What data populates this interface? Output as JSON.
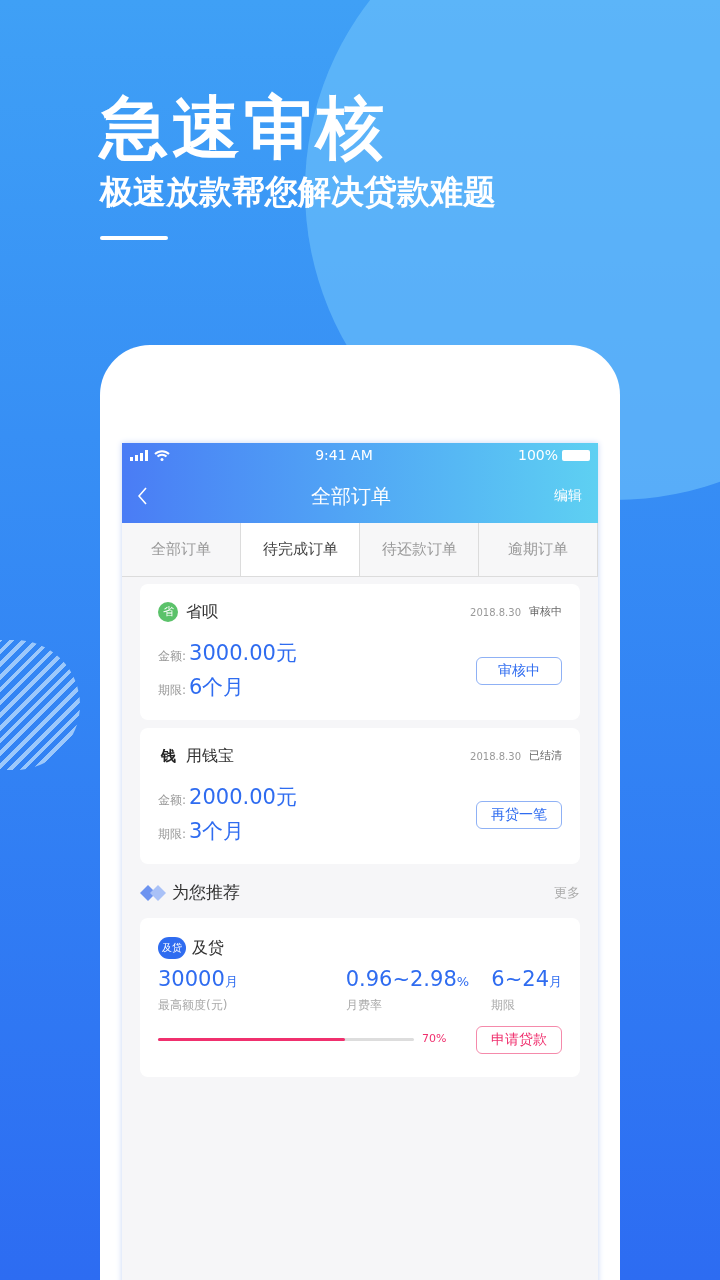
{
  "headline": {
    "title": "急速审核",
    "subtitle": "极速放款帮您解决贷款难题"
  },
  "status_bar": {
    "time": "9:41 AM",
    "battery": "100%"
  },
  "nav": {
    "title": "全部订单",
    "action": "编辑"
  },
  "tabs": [
    {
      "label": "全部订单",
      "selected": false
    },
    {
      "label": "待完成订单",
      "selected": true
    },
    {
      "label": "待还款订单",
      "selected": false
    },
    {
      "label": "逾期订单",
      "selected": false
    }
  ],
  "orders": [
    {
      "logo": "省",
      "kind": "round",
      "name": "省呗",
      "date": "2018.8.30",
      "status": "审核中",
      "amount_label": "金额:",
      "amount": "3000.00元",
      "term_label": "期限:",
      "term": "6个月",
      "button": "审核中"
    },
    {
      "logo": "钱",
      "kind": "plain",
      "name": "用钱宝",
      "date": "2018.8.30",
      "status": "已结清",
      "amount_label": "金额:",
      "amount": "2000.00元",
      "term_label": "期限:",
      "term": "3个月",
      "button": "再贷一笔"
    }
  ],
  "recommend": {
    "title": "为您推荐",
    "more": "更多",
    "product": {
      "logo": "及贷",
      "name": "及贷",
      "stats": [
        {
          "value": "30000",
          "unit": "月",
          "label": "最高额度(元)"
        },
        {
          "value": "0.96~2.98",
          "unit": "%",
          "label": "月费率"
        },
        {
          "value": "6~24",
          "unit": "月",
          "label": "期限"
        }
      ],
      "level": 0.73,
      "percent": "70%",
      "button": "申请贷款"
    }
  }
}
